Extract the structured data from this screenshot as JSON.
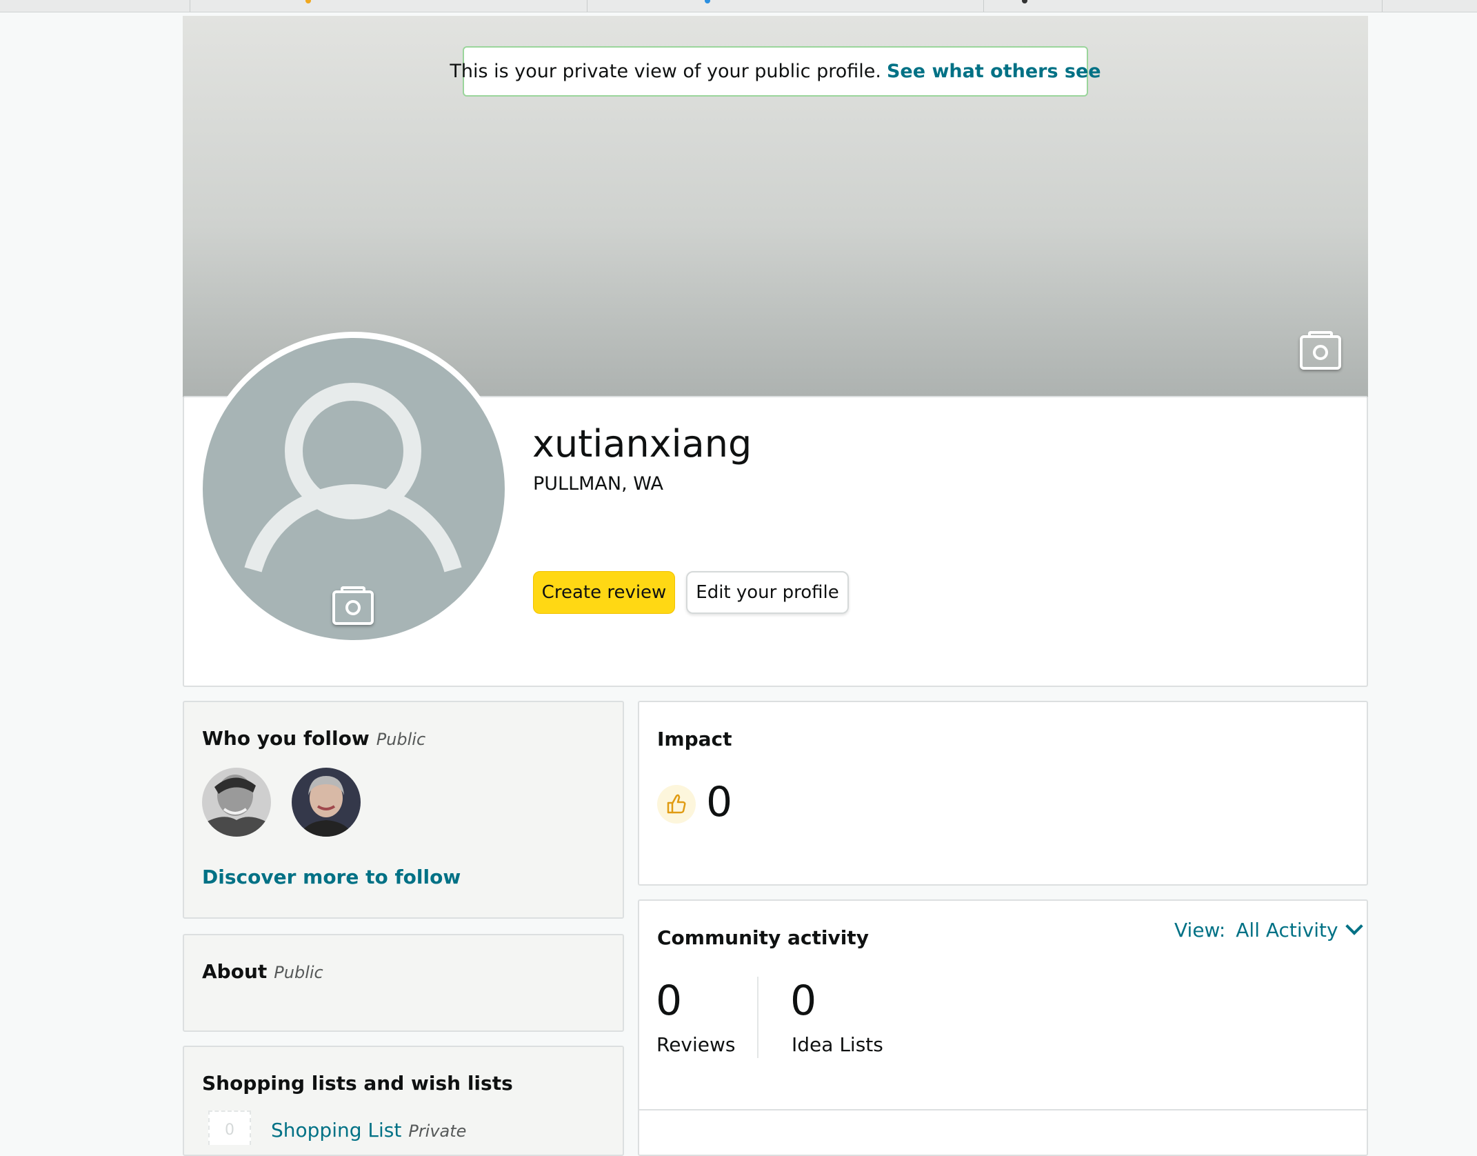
{
  "notice": {
    "text": "This is your private view of your public profile.",
    "link": "See what others see"
  },
  "profile": {
    "username": "xutianxiang",
    "location": "PULLMAN, WA"
  },
  "actions": {
    "create_review": "Create review",
    "edit_profile": "Edit your profile"
  },
  "follow": {
    "title": "Who you follow",
    "tag": "Public",
    "discover_link": "Discover more to follow"
  },
  "about": {
    "title": "About",
    "tag": "Public"
  },
  "lists": {
    "title": "Shopping lists and wish lists",
    "items": [
      {
        "count": "0",
        "name": "Shopping List",
        "tag": "Private"
      }
    ]
  },
  "impact": {
    "title": "Impact",
    "value": "0"
  },
  "community": {
    "title": "Community activity",
    "view_label": "View:",
    "view_value": "All Activity",
    "stats": [
      {
        "value": "0",
        "label": "Reviews"
      },
      {
        "value": "0",
        "label": "Idea Lists"
      }
    ]
  },
  "colors": {
    "link": "#007185",
    "primary_button": "#ffd814",
    "avatar_placeholder": "#a7b4b5",
    "notice_border": "#9ad59b"
  },
  "icons": [
    "camera-icon",
    "user-placeholder-icon",
    "thumbs-up-icon",
    "chevron-down-icon"
  ]
}
